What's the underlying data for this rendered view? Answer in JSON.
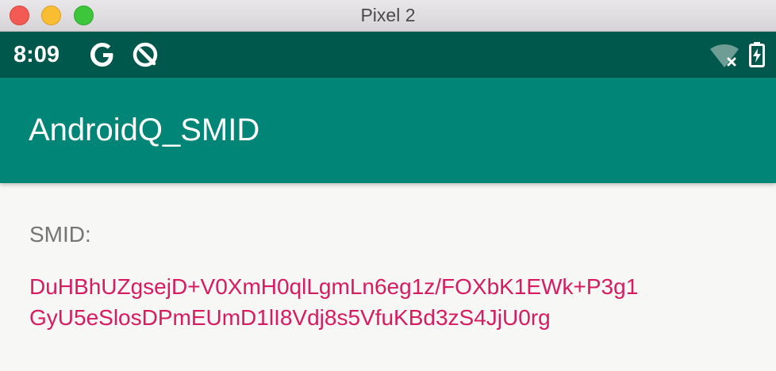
{
  "window": {
    "title": "Pixel 2"
  },
  "status_bar": {
    "time": "8:09",
    "left_icons": [
      "google-g-icon",
      "android-q-icon"
    ],
    "right_icons": [
      "wifi-no-internet-icon",
      "battery-charging-icon"
    ]
  },
  "app_bar": {
    "title": "AndroidQ_SMID"
  },
  "content": {
    "smid_label": "SMID:",
    "smid_line1": "DuHBhUZgsejD+V0XmH0qlLgmLn6eg1z/FOXbK1EWk+P3g1",
    "smid_line2": "GyU5eSlosDPmEUmD1lI8Vdj8s5VfuKBd3zS4JjU0rg"
  },
  "colors": {
    "status_bar": "#00574b",
    "app_bar": "#008577",
    "accent_text": "#d81b60",
    "label_text": "#757575",
    "background": "#f7f7f5"
  }
}
